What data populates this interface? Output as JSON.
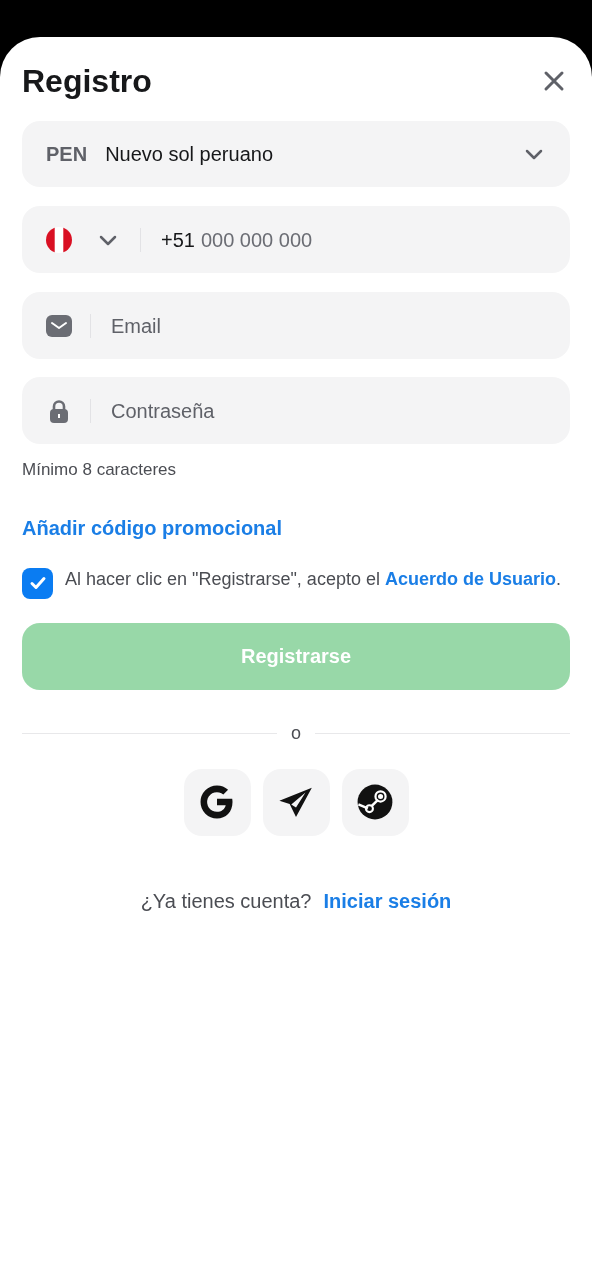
{
  "dialog": {
    "title": "Registro"
  },
  "currency": {
    "code": "PEN",
    "name": "Nuevo sol peruano"
  },
  "phone": {
    "prefix": "+51",
    "placeholder": "000 000 000"
  },
  "email": {
    "placeholder": "Email"
  },
  "password": {
    "placeholder": "Contraseña",
    "hint": "Mínimo 8 caracteres"
  },
  "promo_link": "Añadir código promocional",
  "agreement": {
    "checked": true,
    "text": "Al hacer clic en \"Registrarse\", acepto el",
    "link": "Acuerdo de Usuario",
    "end": "."
  },
  "submit": {
    "label": "Registrarse",
    "disabled": true
  },
  "divider": "o",
  "social": [
    {
      "kind": "google"
    },
    {
      "kind": "telegram"
    },
    {
      "kind": "steam"
    }
  ],
  "footer": {
    "text": "¿Ya tienes cuenta?",
    "link": "Iniciar sesión"
  }
}
